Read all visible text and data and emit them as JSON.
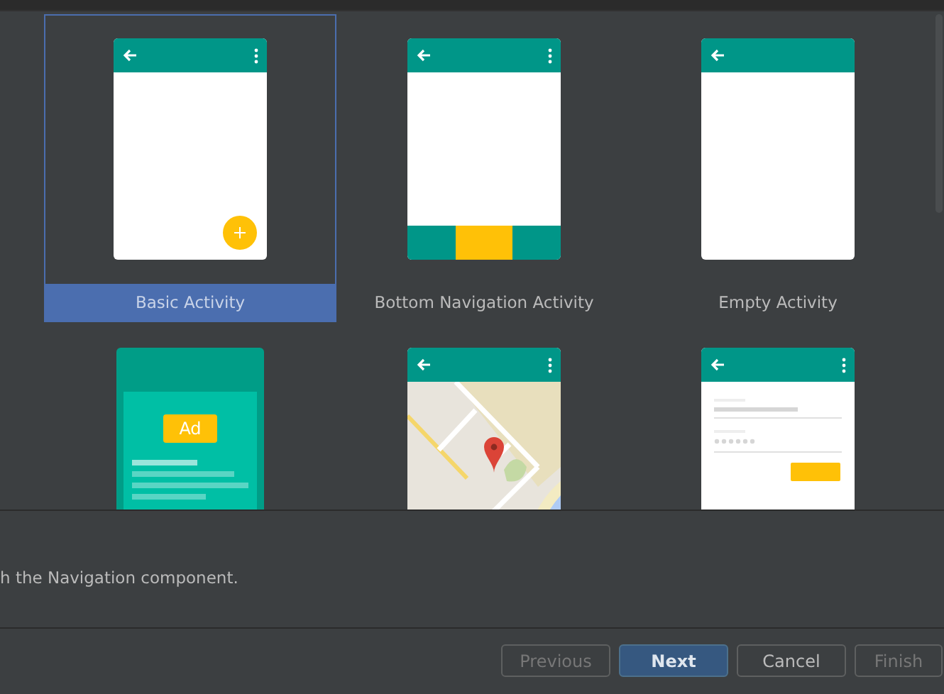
{
  "templates": [
    {
      "kind": "basic",
      "label": "Basic Activity",
      "selected": true
    },
    {
      "kind": "bottom_nav",
      "label": "Bottom Navigation Activity",
      "selected": false
    },
    {
      "kind": "empty",
      "label": "Empty Activity",
      "selected": false
    },
    {
      "kind": "ad",
      "ad_text": "Ad",
      "selected": false
    },
    {
      "kind": "map",
      "selected": false
    },
    {
      "kind": "login",
      "selected": false
    }
  ],
  "description": "h the Navigation component.",
  "buttons": [
    {
      "label": "Previous",
      "kind": "default",
      "disabled": true
    },
    {
      "label": "Next",
      "kind": "primary",
      "disabled": false
    },
    {
      "label": "Cancel",
      "kind": "default",
      "disabled": false
    },
    {
      "label": "Finish",
      "kind": "default",
      "disabled": true
    }
  ]
}
